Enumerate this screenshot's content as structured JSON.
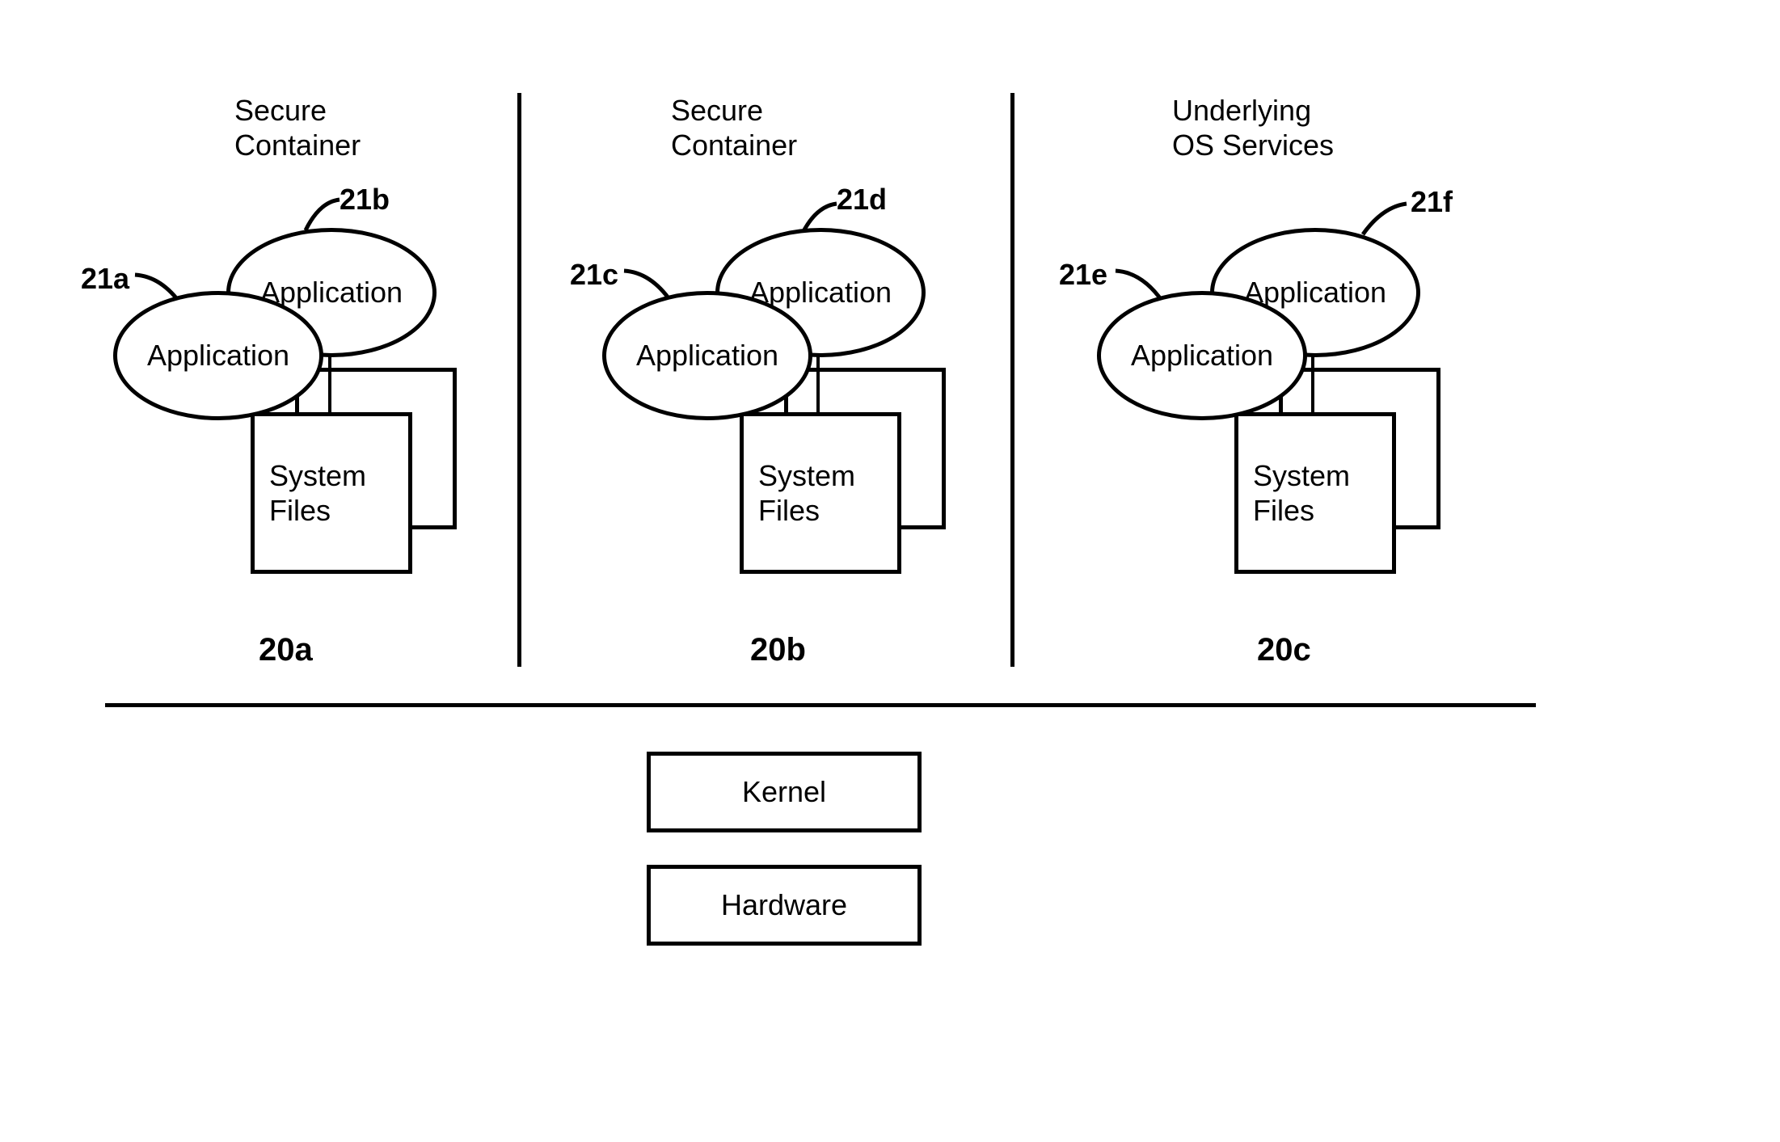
{
  "columns": [
    {
      "title": "Secure\nContainer",
      "id": "20a",
      "app_left_ref": "21a",
      "app_right_ref": "21b",
      "app_left_label": "Application",
      "app_right_label": "Application",
      "files_label": "System\nFiles"
    },
    {
      "title": "Secure\nContainer",
      "id": "20b",
      "app_left_ref": "21c",
      "app_right_ref": "21d",
      "app_left_label": "Application",
      "app_right_label": "Application",
      "files_label": "System\nFiles"
    },
    {
      "title": "Underlying\nOS Services",
      "id": "20c",
      "app_left_ref": "21e",
      "app_right_ref": "21f",
      "app_left_label": "Application",
      "app_right_label": "Application",
      "files_label": "System\nFiles"
    }
  ],
  "bottom": {
    "kernel": "Kernel",
    "hardware": "Hardware"
  }
}
